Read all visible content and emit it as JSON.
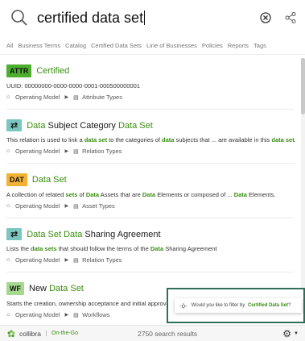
{
  "search": {
    "value": "certified data set"
  },
  "tabs": [
    "All",
    "Business Terms",
    "Catalog",
    "Certified Data Sets",
    "Line of Businesses",
    "Policies",
    "Reports",
    "Tags"
  ],
  "results": [
    {
      "badge": "ATTR",
      "title_parts": [
        "Certified"
      ],
      "uuid": "UUID: 00000000-0000-0000-0001-000500000001",
      "meta": [
        "Operating Model",
        "Attribute Types"
      ]
    },
    {
      "badge": "⇄",
      "title_plain": "Data",
      "title_rest": " Subject Category ",
      "title_hl": "Data Set",
      "desc_parts": [
        "This relation is used to link a ",
        "data set",
        " to the categories of ",
        "data",
        " subjects that ... are available in this ",
        "data set",
        "."
      ],
      "meta": [
        "Operating Model",
        "Relation Types"
      ]
    },
    {
      "badge": "DAT",
      "title": "Data Set",
      "desc_parts": [
        "A collection of related ",
        "sets",
        " of ",
        "Data",
        " Assets that are ",
        "Data",
        " Elements or composed of ... ",
        "Data",
        " Elements."
      ],
      "meta": [
        "Operating Model",
        "Asset Types"
      ]
    },
    {
      "badge": "⇄",
      "title_a": "Data Set Data",
      "title_b": " Sharing Agreement",
      "desc_parts": [
        "Lists the ",
        "data sets",
        " that should follow the terms of the ",
        "Data",
        " Sharing Agreement"
      ],
      "meta": [
        "Operating Model",
        "Relation Types"
      ]
    },
    {
      "badge": "WF",
      "title_a": "New ",
      "title_b": "Data Set",
      "desc": "Starts the creation, ownership acceptance and initial approval",
      "meta": [
        "Operating Model",
        "Workflows"
      ]
    }
  ],
  "tooltip": {
    "text": "Would you like to filter by",
    "link": "Certified Data Set",
    "suffix": "?"
  },
  "footer": {
    "brand": "collibra",
    "mode": "On-the-Go",
    "count": "2750 search results"
  },
  "colors": {
    "accent_green": "#3a8e10",
    "attr_badge": "#4cb02e",
    "dat_badge": "#f3b234",
    "wf_badge": "#a6d88f",
    "rel_badge": "#7cc6c0",
    "tooltip_border": "#2f6e59"
  }
}
